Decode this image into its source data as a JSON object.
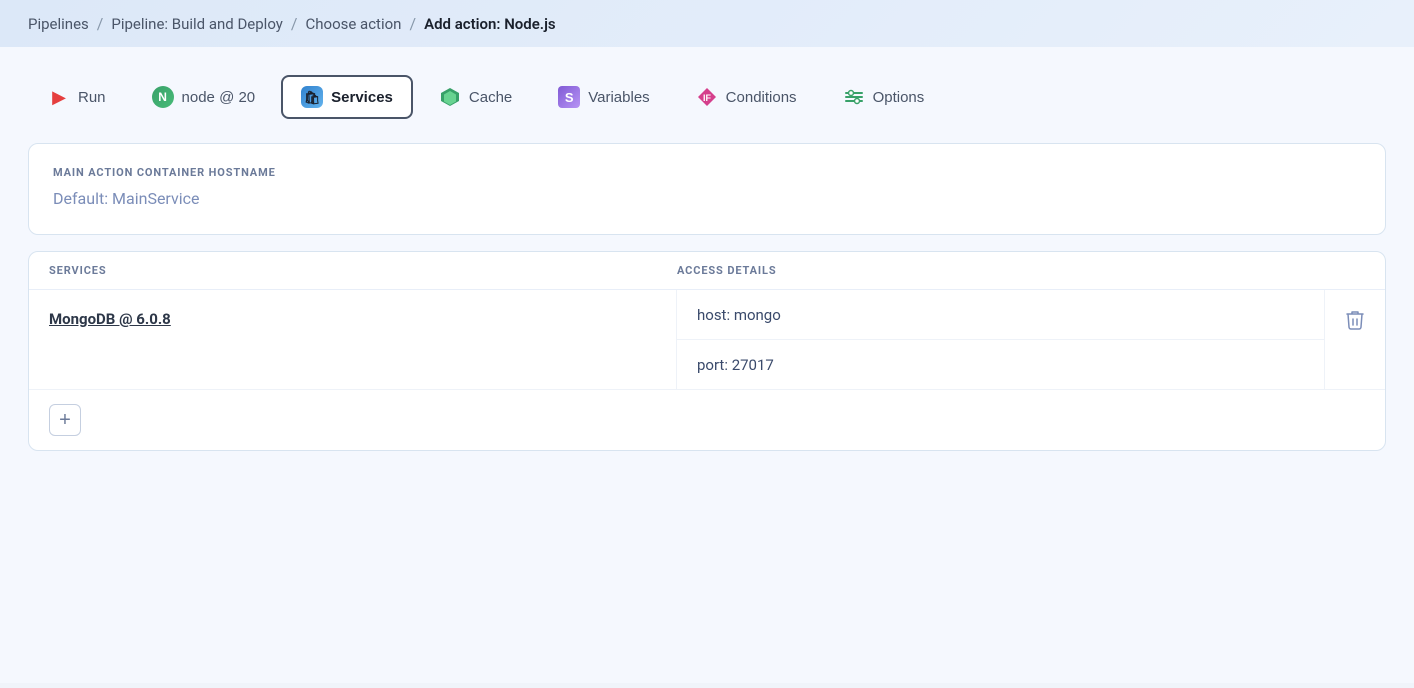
{
  "breadcrumb": {
    "items": [
      {
        "label": "Pipelines",
        "link": true
      },
      {
        "label": "Pipeline: Build and Deploy",
        "link": true
      },
      {
        "label": "Choose action",
        "link": true
      },
      {
        "label": "Add action: Node.js",
        "link": false
      }
    ],
    "separator": "/"
  },
  "tabs": [
    {
      "id": "run",
      "label": "Run",
      "icon": "run-icon",
      "active": false
    },
    {
      "id": "node",
      "label": "node @ 20",
      "icon": "node-icon",
      "active": false
    },
    {
      "id": "services",
      "label": "Services",
      "icon": "services-icon",
      "active": true
    },
    {
      "id": "cache",
      "label": "Cache",
      "icon": "cache-icon",
      "active": false
    },
    {
      "id": "variables",
      "label": "Variables",
      "icon": "variables-icon",
      "active": false
    },
    {
      "id": "conditions",
      "label": "Conditions",
      "icon": "conditions-icon",
      "active": false
    },
    {
      "id": "options",
      "label": "Options",
      "icon": "options-icon",
      "active": false
    }
  ],
  "hostname_card": {
    "label": "MAIN ACTION CONTAINER HOSTNAME",
    "placeholder": "Default: MainService"
  },
  "services_table": {
    "col_services": "SERVICES",
    "col_access": "ACCESS DETAILS",
    "rows": [
      {
        "name": "MongoDB @ 6.0.8",
        "access_details": [
          "host: mongo",
          "port: 27017"
        ]
      }
    ]
  },
  "buttons": {
    "add": "+",
    "delete": "🗑"
  }
}
